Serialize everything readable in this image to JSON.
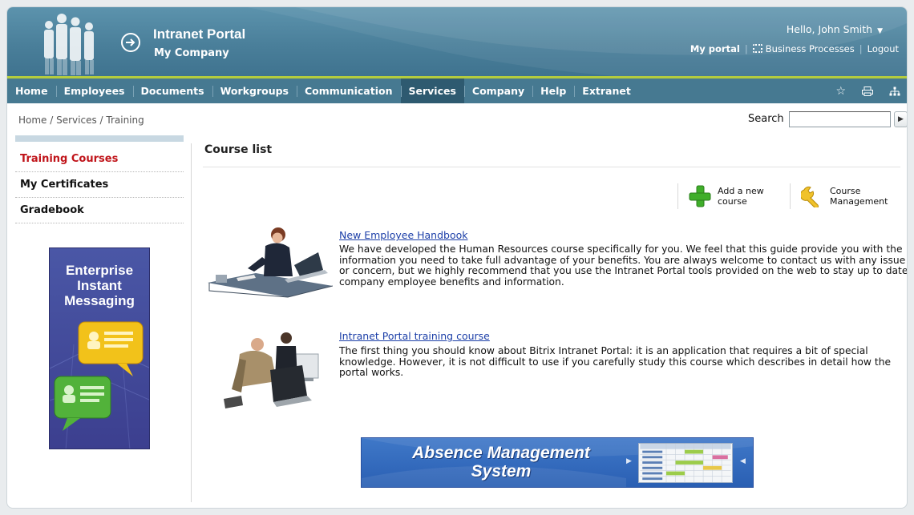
{
  "header": {
    "title": "Intranet Portal",
    "company": "My Company",
    "greeting": "Hello, John Smith",
    "links": {
      "my_portal": "My portal",
      "business_processes": "Business Processes",
      "logout": "Logout"
    }
  },
  "nav": {
    "items": [
      "Home",
      "Employees",
      "Documents",
      "Workgroups",
      "Communication",
      "Services",
      "Company",
      "Help",
      "Extranet"
    ],
    "active": "Services",
    "icons": [
      "star-icon",
      "print-icon",
      "sitemap-icon"
    ]
  },
  "breadcrumb": "Home / Services / Training",
  "search": {
    "label": "Search",
    "value": ""
  },
  "sidebar": {
    "items": [
      {
        "label": "Training Courses",
        "active": true
      },
      {
        "label": "My Certificates",
        "active": false
      },
      {
        "label": "Gradebook",
        "active": false
      }
    ],
    "ad_text": "Enterprise Instant Messaging"
  },
  "main": {
    "heading": "Course list",
    "actions": {
      "add_course": "Add a new course",
      "course_management": "Course Management"
    },
    "courses": [
      {
        "title": "New Employee Handbook",
        "description": "We have developed the Human Resources course specifically for you. We feel that this guide provide you with the information you need to take full advantage of your benefits. You are always welcome to contact us with any issue or concern, but we highly recommend that you use the Intranet Portal tools provided on the web to stay up to date company employee benefits and information."
      },
      {
        "title": "Intranet Portal training course",
        "description": "The first thing you should know about Bitrix Intranet Portal: it is an application that requires a bit of special knowledge. However, it is not difficult to use if you carefully study this course which describes in detail how the portal works."
      }
    ],
    "banner_text": "Absence Management System"
  },
  "colors": {
    "header": "#4a7f9a",
    "nav": "#467991",
    "nav_accent": "#b4cc3e",
    "active_side": "#c0141a",
    "link": "#1c3fa8"
  }
}
